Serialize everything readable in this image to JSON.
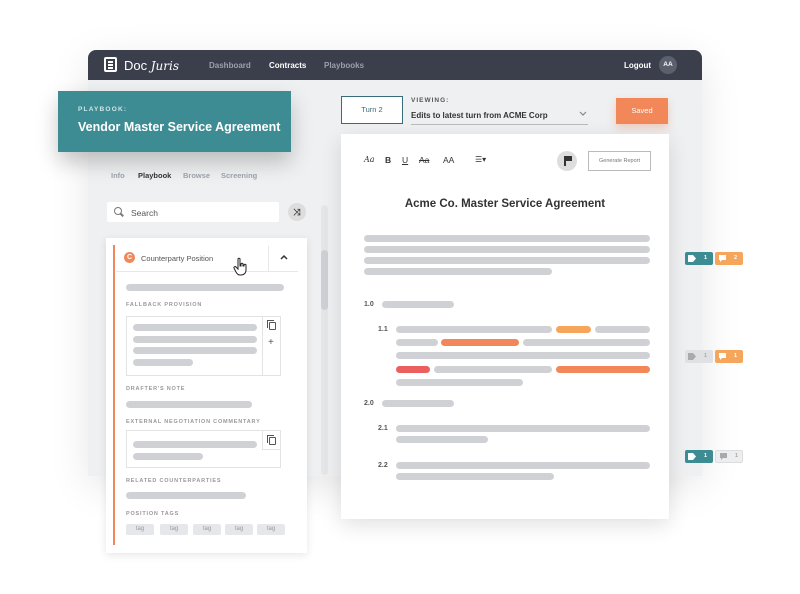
{
  "nav": {
    "logo_doc": "Doc",
    "logo_juris": "Juris",
    "links": [
      "Dashboard",
      "Contracts",
      "Playbooks"
    ],
    "logout": "Logout",
    "avatar": "AA"
  },
  "playbook": {
    "kicker": "PLAYBOOK:",
    "title": "Vendor Master Service Agreement"
  },
  "subtabs": [
    "Info",
    "Playbook",
    "Browse",
    "Screening"
  ],
  "search": {
    "placeholder": "Search"
  },
  "position_card": {
    "title": "Counterparty Position",
    "sections": {
      "fallback": "FALLBACK PROVISION",
      "drafter": "DRAFTER'S NOTE",
      "external": "EXTERNAL NEGOTIATION COMMENTARY",
      "related": "RELATED COUNTERPARTIES",
      "tags": "POSITION TAGS"
    },
    "tags": [
      "tag",
      "tag",
      "tag",
      "tag",
      "tag"
    ],
    "plus": "+"
  },
  "turn": {
    "label": "Turn 2"
  },
  "viewing": {
    "label": "VIEWING:",
    "value": "Edits to latest turn from ACME Corp"
  },
  "saved_label": "Saved",
  "toolbar": {
    "font": "Aa",
    "bold": "B",
    "underline": "U",
    "strike": "Aa",
    "size": "AA",
    "list": "☰▾",
    "generate": "Generate Report"
  },
  "document": {
    "title": "Acme Co. Master Service Agreement",
    "sections": [
      "1.0",
      "1.1",
      "2.0",
      "2.1",
      "2.2"
    ]
  },
  "annotations": [
    {
      "tag_count": "1",
      "comment_count": "2"
    },
    {
      "tag_count": "1",
      "comment_count": "1"
    },
    {
      "tag_count": "1",
      "comment_count": "1"
    }
  ],
  "colors": {
    "teal": "#3d8c93",
    "orange": "#f2875a",
    "nav": "#3a3f4b"
  }
}
